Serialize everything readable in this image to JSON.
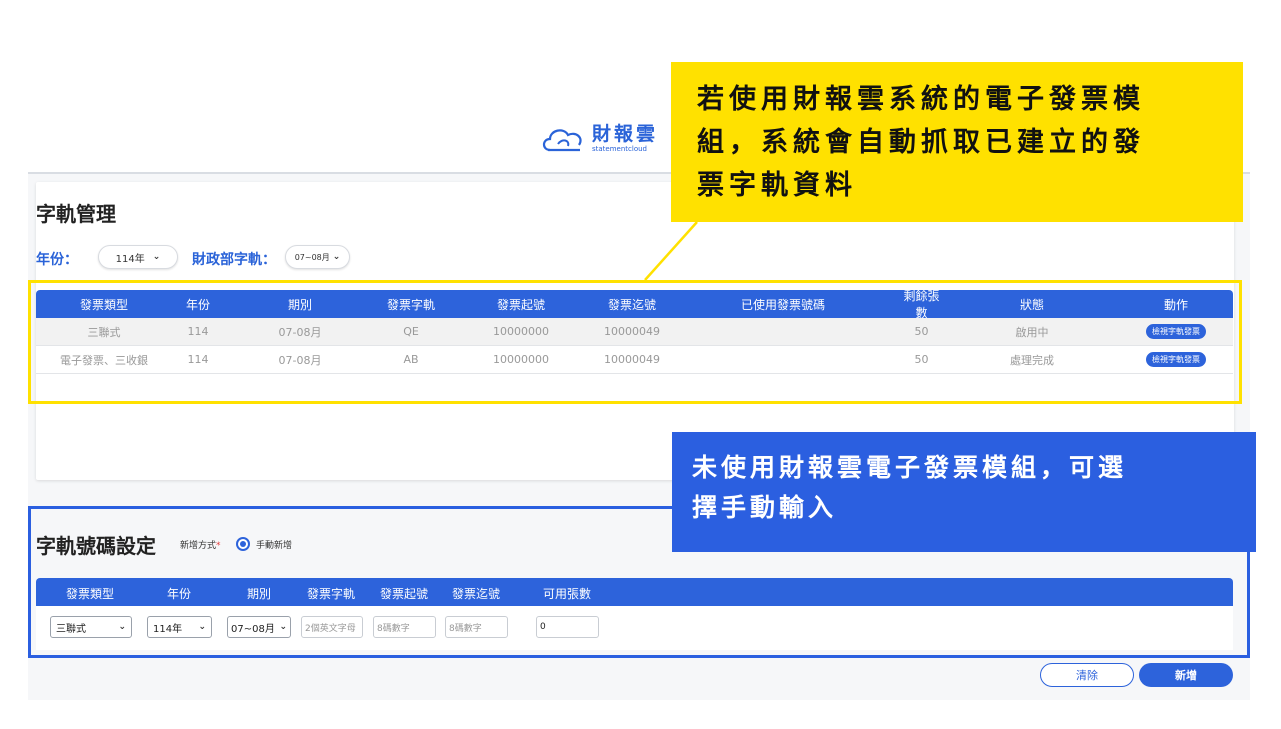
{
  "logo": {
    "main": "財報雲",
    "sub": "statementcloud"
  },
  "invoice_track": {
    "title": "字軌管理",
    "year_label": "年份：",
    "year_value": "114年",
    "mof_label": "財政部字軌：",
    "period_value": "07~08月",
    "columns": [
      "發票類型",
      "年份",
      "期別",
      "發票字軌",
      "發票起號",
      "發票迄號",
      "已使用發票號碼",
      "剩餘張數",
      "狀態",
      "動作"
    ],
    "rows": [
      [
        "三聯式",
        "114",
        "07-08月",
        "QE",
        "10000000",
        "10000049",
        "",
        "50",
        "啟用中",
        "檢視字軌發票"
      ],
      [
        "電子發票、三收銀",
        "114",
        "07-08月",
        "AB",
        "10000000",
        "10000049",
        "",
        "50",
        "處理完成",
        "檢視字軌發票"
      ]
    ]
  },
  "callouts": {
    "yellow": [
      "若使用財報雲系統的電子發票模",
      "組，系統會自動抓取已建立的發",
      "票字軌資料"
    ],
    "blue": [
      "未使用財報雲電子發票模組，可選",
      "擇手動輸入"
    ]
  },
  "number_setting": {
    "title": "字軌號碼設定",
    "mode_label": "新增方式",
    "required_mark": "*",
    "mode_option": "手動新增",
    "columns": [
      "發票類型",
      "年份",
      "期別",
      "發票字軌",
      "發票起號",
      "發票迄號",
      "可用張數"
    ],
    "invoice_type": "三聯式",
    "year": "114年",
    "period": "07~08月",
    "track_placeholder": "2個英文字母",
    "start_placeholder": "8碼數字",
    "end_placeholder": "8碼數字",
    "available": "0"
  },
  "buttons": {
    "clear": "清除",
    "add": "新增"
  },
  "colors": {
    "primary": "#2d63db",
    "highlight_yellow": "#ffe100",
    "highlight_blue": "#2b5fe0"
  }
}
